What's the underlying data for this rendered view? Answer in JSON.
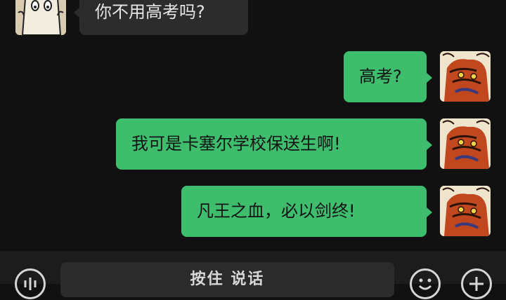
{
  "messages": [
    {
      "direction": "incoming",
      "text": "你不用高考吗?",
      "avatar": "cartoon-face-avatar"
    },
    {
      "direction": "outgoing",
      "text": "高考?",
      "avatar": "red-dragon-avatar"
    },
    {
      "direction": "outgoing",
      "text": "我可是卡塞尔学校保送生啊!",
      "avatar": "red-dragon-avatar"
    },
    {
      "direction": "outgoing",
      "text": "凡王之血，必以剑终!",
      "avatar": "red-dragon-avatar"
    }
  ],
  "input_bar": {
    "voice_toggle_icon": "voice-wave-icon",
    "hold_to_talk_label": "按住 说话",
    "emoji_icon": "emoji-face-icon",
    "plus_icon": "plus-icon"
  },
  "colors": {
    "background": "#111111",
    "incoming_bubble": "#2c2c2c",
    "outgoing_bubble": "#3ebd6d"
  }
}
